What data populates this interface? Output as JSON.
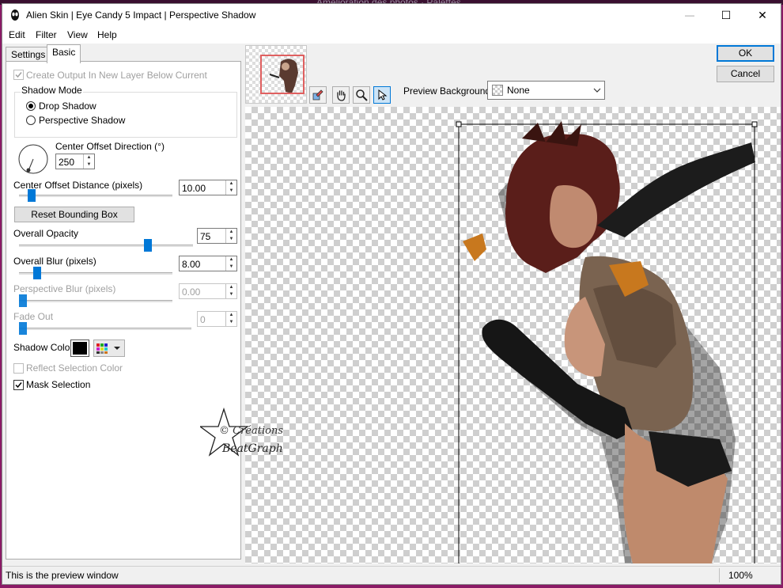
{
  "background_window": {
    "text": "Amélioration des photos  ·  Palettes"
  },
  "window": {
    "title": "Alien Skin | Eye Candy 5 Impact | Perspective Shadow",
    "controls": {
      "minimize": "—",
      "maximize": "☐",
      "close": "✕"
    }
  },
  "menu": [
    "Edit",
    "Filter",
    "View",
    "Help"
  ],
  "tabs": [
    "Settings",
    "Basic"
  ],
  "basic": {
    "create_output": "Create Output In New Layer Below Current",
    "shadow_mode": {
      "title": "Shadow Mode",
      "options": [
        "Drop Shadow",
        "Perspective Shadow"
      ],
      "selected": "Drop Shadow"
    },
    "center_offset_direction": {
      "label": "Center Offset Direction (°)",
      "value": "250"
    },
    "center_offset_distance": {
      "label": "Center Offset Distance (pixels)",
      "value": "10.00",
      "slider_fraction": 0.06
    },
    "reset_bounding_box": "Reset Bounding Box",
    "overall_opacity": {
      "label": "Overall Opacity",
      "value": "75",
      "slider_fraction": 0.75
    },
    "overall_blur": {
      "label": "Overall Blur (pixels)",
      "value": "8.00",
      "slider_fraction": 0.1
    },
    "perspective_blur": {
      "label": "Perspective Blur (pixels)",
      "value": "0.00",
      "slider_fraction": 0.0
    },
    "fade_out": {
      "label": "Fade Out",
      "value": "0",
      "slider_fraction": 0.0
    },
    "shadow_color": {
      "label": "Shadow Color",
      "color": "#000000"
    },
    "reflect_selection_color": "Reflect Selection Color",
    "mask_selection": "Mask Selection"
  },
  "buttons": {
    "ok": "OK",
    "cancel": "Cancel"
  },
  "preview_toolbar": {
    "preview_background_label": "Preview Background:",
    "preview_background_value": "None"
  },
  "watermark": {
    "line1": "© Créations",
    "line2": "BeatGraph"
  },
  "status": {
    "text": "This is the preview window",
    "zoom": "100%"
  },
  "colors": {
    "accent": "#0078d7",
    "checker": "#cfcfcf"
  }
}
